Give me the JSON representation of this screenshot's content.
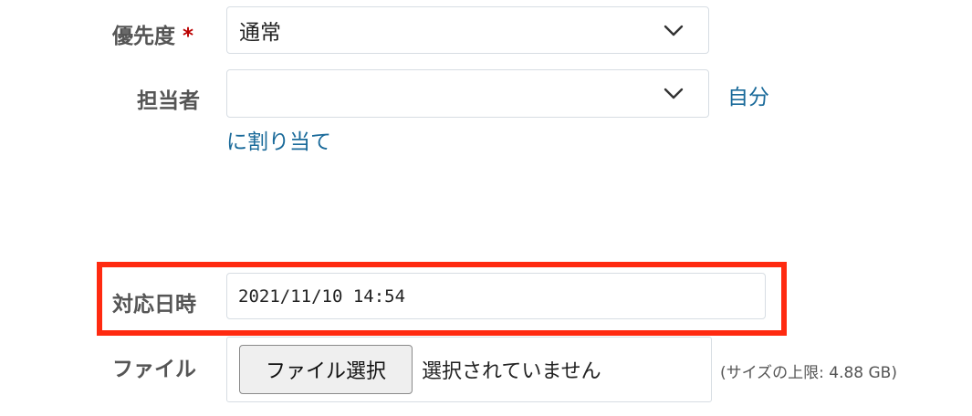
{
  "form": {
    "priority": {
      "label": "優先度",
      "required_mark": "*",
      "selected": "通常"
    },
    "assignee": {
      "label": "担当者",
      "selected": "",
      "assign_me_link_line1": "自分",
      "assign_me_link_line2": "に割り当て"
    },
    "response_datetime": {
      "label": "対応日時",
      "value": "2021/11/10 14:54",
      "highlight_color": "#ff2a10"
    },
    "file": {
      "label": "ファイル",
      "choose_button": "ファイル選択",
      "status": "選択されていません",
      "size_note": "(サイズの上限: 4.88 GB)"
    }
  },
  "colors": {
    "label": "#555555",
    "required": "#bb0000",
    "link": "#1a6a9a",
    "input_border": "#d7dde3"
  },
  "icons": {
    "dropdown": "chevron-down-icon"
  }
}
